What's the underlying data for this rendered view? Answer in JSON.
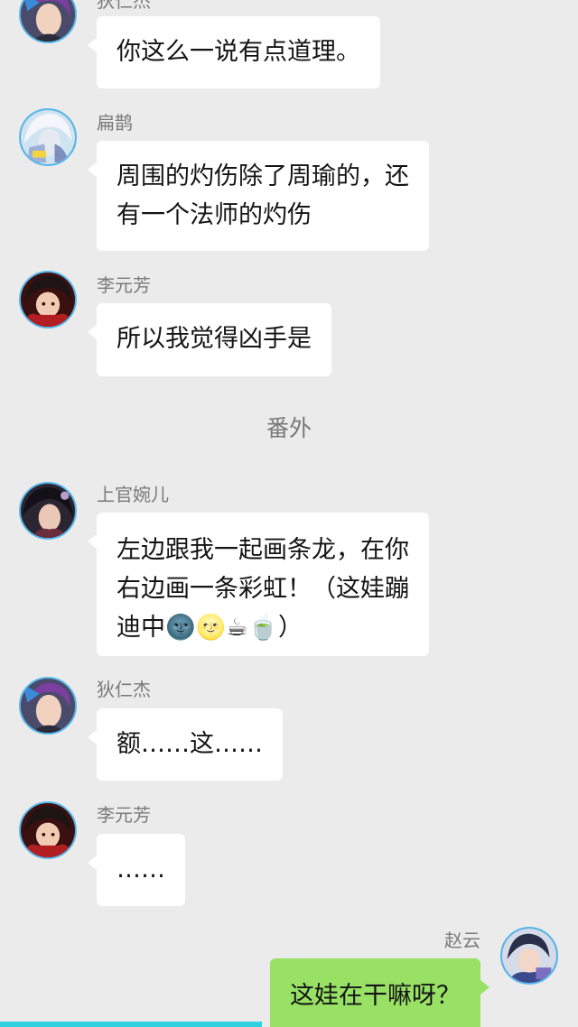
{
  "messages": [
    {
      "sender": "狄仁杰",
      "lines": [
        "你这么一说有点道理。"
      ],
      "avatar_icon": "di-renjie-avatar-icon"
    },
    {
      "sender": "扁鹊",
      "lines": [
        "周围的灼伤除了周瑜的，还",
        "有一个法师的灼伤"
      ],
      "avatar_icon": "bian-que-avatar-icon"
    },
    {
      "sender": "李元芳",
      "lines": [
        "所以我觉得凶手是"
      ],
      "avatar_icon": "li-yuanfang-avatar-icon"
    },
    {
      "sender": "上官婉儿",
      "lines": [
        "左边跟我一起画条龙，在你",
        "右边画一条彩虹！（这娃蹦",
        "迪中🌚🌝☕🍵）"
      ],
      "avatar_icon": "shangguan-waner-avatar-icon"
    },
    {
      "sender": "狄仁杰",
      "lines": [
        "额……这……"
      ],
      "avatar_icon": "di-renjie-avatar-icon"
    },
    {
      "sender": "李元芳",
      "lines": [
        "……"
      ],
      "avatar_icon": "li-yuanfang-avatar-icon"
    },
    {
      "sender": "赵云",
      "lines": [
        "这娃在干嘛呀？"
      ],
      "avatar_icon": "zhao-yun-avatar-icon",
      "outgoing": true
    }
  ],
  "divider": {
    "label": "番外"
  },
  "colors": {
    "background": "#ebebeb",
    "incoming_bubble": "#ffffff",
    "outgoing_bubble": "#98e165",
    "avatar_ring": "#56b8ec",
    "sender_name": "#7a7a7a",
    "bottom_bar": "#2fd2e0"
  }
}
